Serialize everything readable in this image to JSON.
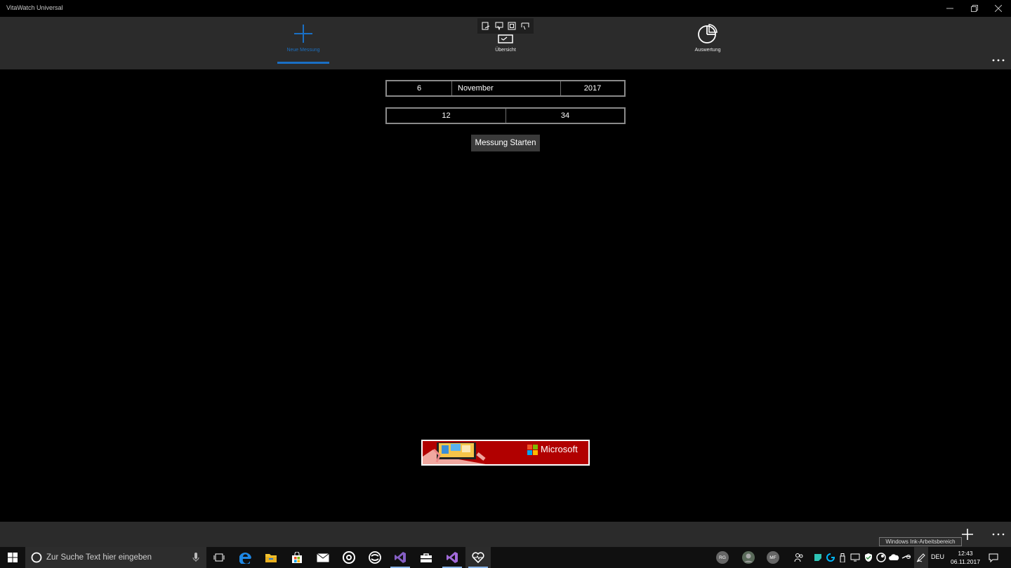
{
  "window": {
    "title": "VitaWatch Universal"
  },
  "nav": {
    "items": [
      {
        "label": "Neue Messung",
        "icon": "plus-icon"
      },
      {
        "label": "Übersicht",
        "icon": "overview-icon"
      },
      {
        "label": "Auswertung",
        "icon": "pie-chart-icon"
      }
    ],
    "active_index": 0
  },
  "date": {
    "day": "6",
    "month": "November",
    "year": "2017"
  },
  "time": {
    "hour": "12",
    "minute": "34"
  },
  "start_button": "Messung Starten",
  "ad": {
    "brand": "Microsoft"
  },
  "tooltip": "Windows Ink-Arbeitsbereich",
  "taskbar": {
    "search_placeholder": "Zur Suche Text hier eingeben",
    "avatars": [
      "RG",
      "MF"
    ],
    "language": "DEU",
    "time": "12:43",
    "date": "06.11.2017"
  },
  "colors": {
    "accent": "#1a6fc4",
    "nav_bg": "#2b2b2b",
    "ad_bg": "#b10000"
  }
}
